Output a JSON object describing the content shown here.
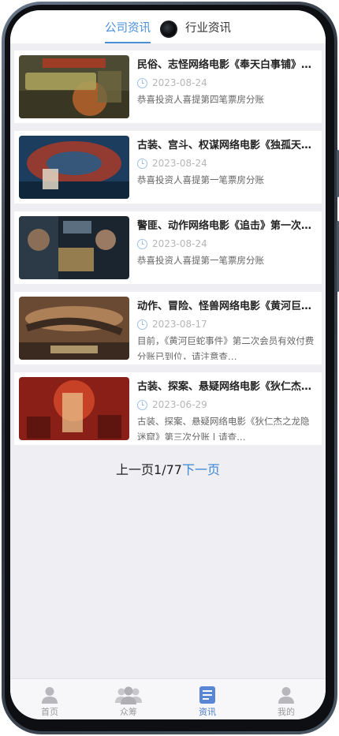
{
  "tabs": [
    {
      "label": "公司资讯",
      "active": true
    },
    {
      "label": "行业资讯",
      "active": false
    }
  ],
  "articles": [
    {
      "title": "民俗、志怪网络电影《奉天白事铺》第…",
      "date": "2023-08-24",
      "desc": "恭喜投资人喜提第四笔票房分账",
      "thumb_colors": [
        "#4d4a33",
        "#a8a05a",
        "#c96a2e"
      ]
    },
    {
      "title": "古装、宫斗、权谋网络电影《独孤天下…",
      "date": "2023-08-24",
      "desc": "恭喜投资人喜提第一笔票房分账",
      "thumb_colors": [
        "#1c3d5e",
        "#b23a26",
        "#e2d6c4"
      ]
    },
    {
      "title": "警匪、动作网络电影《追击》第一次分…",
      "date": "2023-08-24",
      "desc": "恭喜投资人喜提第一笔票房分账",
      "thumb_colors": [
        "#1b2530",
        "#5a6e80",
        "#c9a35c"
      ]
    },
    {
      "title": "动作、冒险、怪兽网络电影《黄河巨蛇…",
      "date": "2023-08-17",
      "desc": "目前，《黄河巨蛇事件》第二次会员有效付费分账已到位，请注意查…",
      "thumb_colors": [
        "#6b4a33",
        "#b88a5e",
        "#3a2a1f"
      ]
    },
    {
      "title": "古装、探案、悬疑网络电影《狄仁杰之…",
      "date": "2023-06-29",
      "desc": "古装、探案、悬疑网络电影《狄仁杰之龙隐迷窟》第三次分账 | 请查…",
      "thumb_colors": [
        "#8a1f17",
        "#d44a2a",
        "#e8c08a"
      ]
    }
  ],
  "pager": {
    "prev": "上一页",
    "current": "1",
    "sep": "/",
    "total": "77",
    "next": "下一页"
  },
  "bottom_nav": [
    {
      "label": "首页",
      "icon": "user-icon",
      "active": false
    },
    {
      "label": "众筹",
      "icon": "group-icon",
      "active": false
    },
    {
      "label": "资讯",
      "icon": "news-icon",
      "active": true
    },
    {
      "label": "我的",
      "icon": "profile-icon",
      "active": false
    }
  ],
  "colors": {
    "accent": "#4a90d9",
    "page_bg": "#efeff3",
    "active_nav": "#4a79c8"
  }
}
